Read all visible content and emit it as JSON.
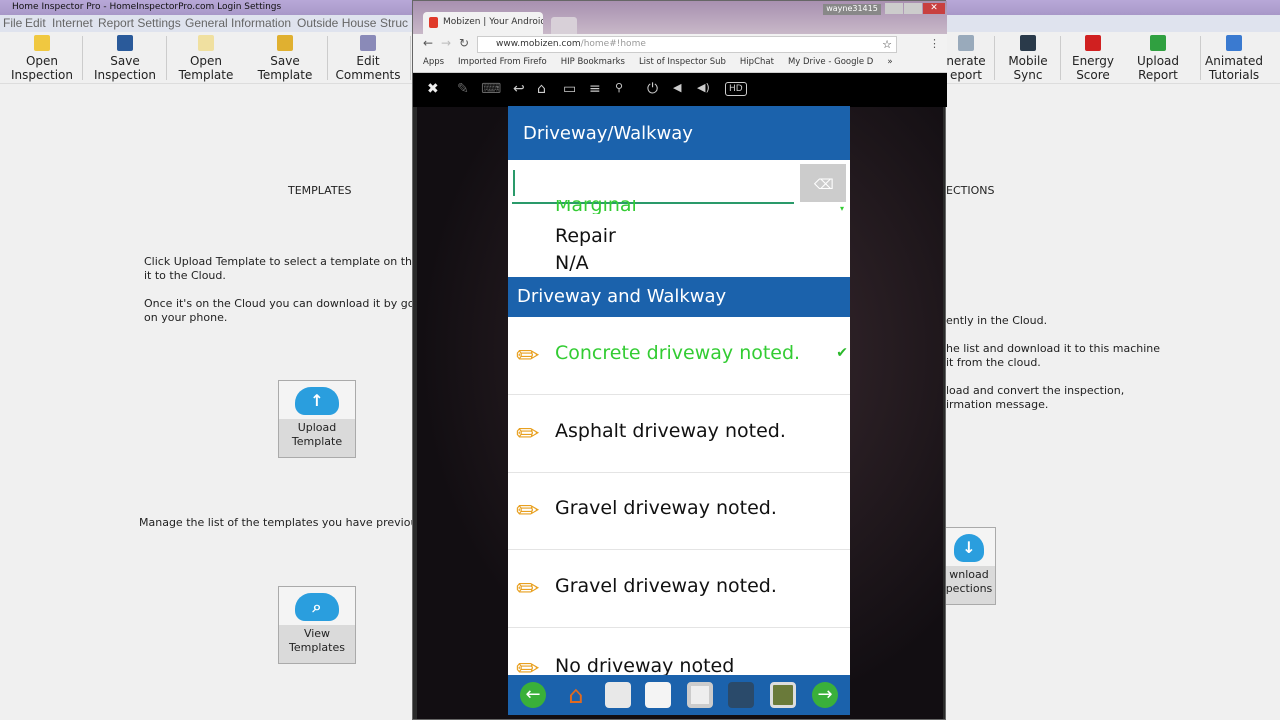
{
  "app": {
    "title": "Home Inspector Pro - HomeInspectorPro.com Login Settings",
    "menu": [
      "File",
      "Edit",
      "Internet",
      "Report Settings",
      "General Information",
      "Outside House",
      "Struc"
    ],
    "toolbar_left": [
      {
        "label1": "Open",
        "label2": "Inspection",
        "icon": "folder-icon",
        "color": "#f0c840"
      },
      {
        "label1": "Save",
        "label2": "Inspection",
        "icon": "floppy-icon",
        "color": "#2a5a9a"
      },
      {
        "label1": "Open",
        "label2": "Template",
        "icon": "document-icon",
        "color": "#f0e0a0"
      },
      {
        "label1": "Save",
        "label2": "Template",
        "icon": "floppy-icon",
        "color": "#e0b030"
      },
      {
        "label1": "Edit",
        "label2": "Comments",
        "icon": "edit-icon",
        "color": "#8a8ab8"
      }
    ],
    "toolbar_right": [
      {
        "label1": "nerate",
        "label2": "eport",
        "icon": "report-icon",
        "color": "#9ab"
      },
      {
        "label1": "Mobile",
        "label2": "Sync",
        "icon": "phone-icon",
        "color": "#2a3a4a"
      },
      {
        "label1": "Energy",
        "label2": "Score",
        "icon": "pen-icon",
        "color": "#d02020"
      },
      {
        "label1": "Upload",
        "label2": "Report",
        "icon": "upload-icon",
        "color": "#30a040"
      },
      {
        "label1": "Animated",
        "label2": "Tutorials",
        "icon": "help-icon",
        "color": "#3a7ad0"
      }
    ],
    "templates": {
      "heading": "TEMPLATES",
      "p1a": "Click Upload Template to select a template on this co",
      "p1b": "it to the Cloud.",
      "p2a": "Once it's on the Cloud you can download it by going t",
      "p2b": "on your phone.",
      "upload_l1": "Upload",
      "upload_l2": "Template",
      "manage": "Manage the list of the templates you have previously s",
      "view_l1": "View",
      "view_l2": "Templates"
    },
    "inspections": {
      "heading": "ECTIONS",
      "p1": "ently in the Cloud.",
      "p2a": "he list and download it to this machine",
      "p2b": "it from the cloud.",
      "p3a": "load and convert the inspection,",
      "p3b": "irmation message.",
      "download_l1": "wnload",
      "download_l2": "pections"
    }
  },
  "browser": {
    "tab_title": "Mobizen | Your Android",
    "user": "wayne31415",
    "url_host": "www.mobizen.com",
    "url_path": "/home#!home",
    "bookmarks": [
      "Apps",
      "Imported From Firefo",
      "HIP Bookmarks",
      "List of Inspector Sub",
      "HipChat",
      "My Drive - Google D"
    ],
    "more": "»",
    "hd": "HD"
  },
  "phone": {
    "title": "Driveway/Walkway",
    "input_value": "",
    "options": [
      "Marginal",
      "Repair",
      "N/A"
    ],
    "section": "Driveway and Walkway",
    "items": [
      {
        "text": "Concrete driveway noted.",
        "selected": true
      },
      {
        "text": "Asphalt driveway noted.",
        "selected": false
      },
      {
        "text": "Gravel driveway noted.",
        "selected": false
      },
      {
        "text": "Gravel driveway noted.",
        "selected": false
      },
      {
        "text": "No driveway noted",
        "selected": false
      }
    ],
    "selected_color": "#33cc33",
    "accent": "#1b62ac"
  }
}
